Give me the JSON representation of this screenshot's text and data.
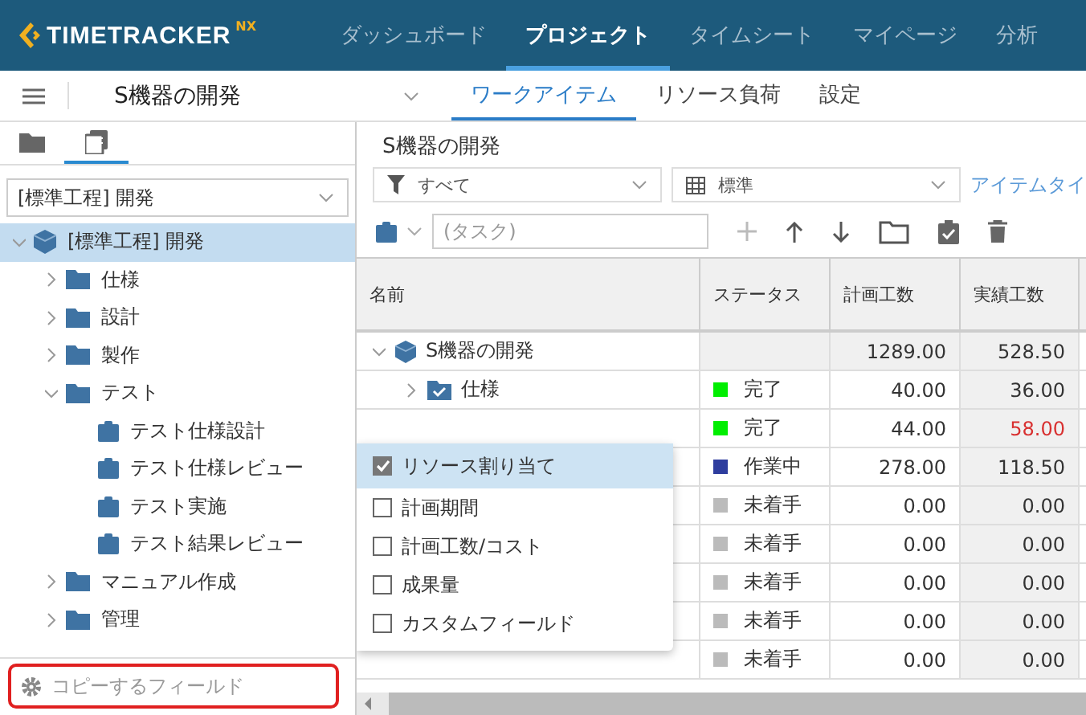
{
  "app": {
    "logo": "TIMETRACKER",
    "logo_suffix": "NX"
  },
  "nav": [
    {
      "label": "ダッシュボード",
      "selected": false
    },
    {
      "label": "プロジェクト",
      "selected": true
    },
    {
      "label": "タイムシート",
      "selected": false
    },
    {
      "label": "マイページ",
      "selected": false
    },
    {
      "label": "分析",
      "selected": false
    }
  ],
  "project": {
    "name": "S機器の開発"
  },
  "subtabs": [
    {
      "label": "ワークアイテム",
      "selected": true
    },
    {
      "label": "リソース負荷",
      "selected": false
    },
    {
      "label": "設定",
      "selected": false
    }
  ],
  "sidebar": {
    "view_tabs": [
      {
        "kind": "folder",
        "selected": false
      },
      {
        "kind": "list",
        "selected": true
      }
    ],
    "select": "[標準工程] 開発",
    "tree": [
      {
        "label": "[標準工程] 開発",
        "kind": "project",
        "expanded": true,
        "selected": true,
        "children": [
          {
            "label": "仕様",
            "kind": "folder",
            "expanded": false,
            "selected": false
          },
          {
            "label": "設計",
            "kind": "folder",
            "expanded": false,
            "selected": false
          },
          {
            "label": "製作",
            "kind": "folder",
            "expanded": false,
            "selected": false
          },
          {
            "label": "テスト",
            "kind": "folder",
            "expanded": true,
            "selected": false,
            "children": [
              {
                "label": "テスト仕様設計",
                "kind": "task",
                "selected": false
              },
              {
                "label": "テスト仕様レビュー",
                "kind": "task",
                "selected": false
              },
              {
                "label": "テスト実施",
                "kind": "task",
                "selected": false
              },
              {
                "label": "テスト結果レビュー",
                "kind": "task",
                "selected": false
              }
            ]
          },
          {
            "label": "マニュアル作成",
            "kind": "folder",
            "expanded": false,
            "selected": false
          },
          {
            "label": "管理",
            "kind": "folder",
            "expanded": false,
            "selected": false
          }
        ]
      }
    ],
    "copy_fields_button": "コピーするフィールド"
  },
  "main": {
    "title": "S機器の開発",
    "filter": "すべて",
    "view": "標準",
    "item_type_link": "アイテムタイ",
    "task_input": {
      "placeholder": "(タスク)"
    },
    "table": {
      "columns": [
        "名前",
        "ステータス",
        "計画工数",
        "実績工数"
      ],
      "rows": [
        {
          "name": "S機器の開発",
          "kind": "project",
          "planned": "1289.00",
          "actual": "528.50",
          "over": false
        },
        {
          "name": "仕様",
          "kind": "folder-done",
          "status": "完了",
          "color": "#00ee00",
          "planned": "40.00",
          "actual": "36.00",
          "over": false
        },
        {
          "status": "完了",
          "color": "#00ee00",
          "planned": "44.00",
          "actual": "58.00",
          "over": true
        },
        {
          "status": "作業中",
          "color": "#2e3d9e",
          "planned": "278.00",
          "actual": "118.50",
          "over": false
        },
        {
          "status": "未着手",
          "color": "#bbbbbb",
          "planned": "0.00",
          "actual": "0.00",
          "over": false
        },
        {
          "status": "未着手",
          "color": "#bbbbbb",
          "planned": "0.00",
          "actual": "0.00",
          "over": false
        },
        {
          "status": "未着手",
          "color": "#bbbbbb",
          "planned": "0.00",
          "actual": "0.00",
          "over": false
        },
        {
          "status": "未着手",
          "color": "#bbbbbb",
          "planned": "0.00",
          "actual": "0.00",
          "over": false
        },
        {
          "status": "未着手",
          "color": "#bbbbbb",
          "planned": "0.00",
          "actual": "0.00",
          "over": false
        }
      ]
    }
  },
  "copy_menu": [
    {
      "label": "リソース割り当て",
      "checked": true
    },
    {
      "label": "計画期間",
      "checked": false
    },
    {
      "label": "計画工数/コスト",
      "checked": false
    },
    {
      "label": "成果量",
      "checked": false
    },
    {
      "label": "カスタムフィールド",
      "checked": false
    }
  ]
}
